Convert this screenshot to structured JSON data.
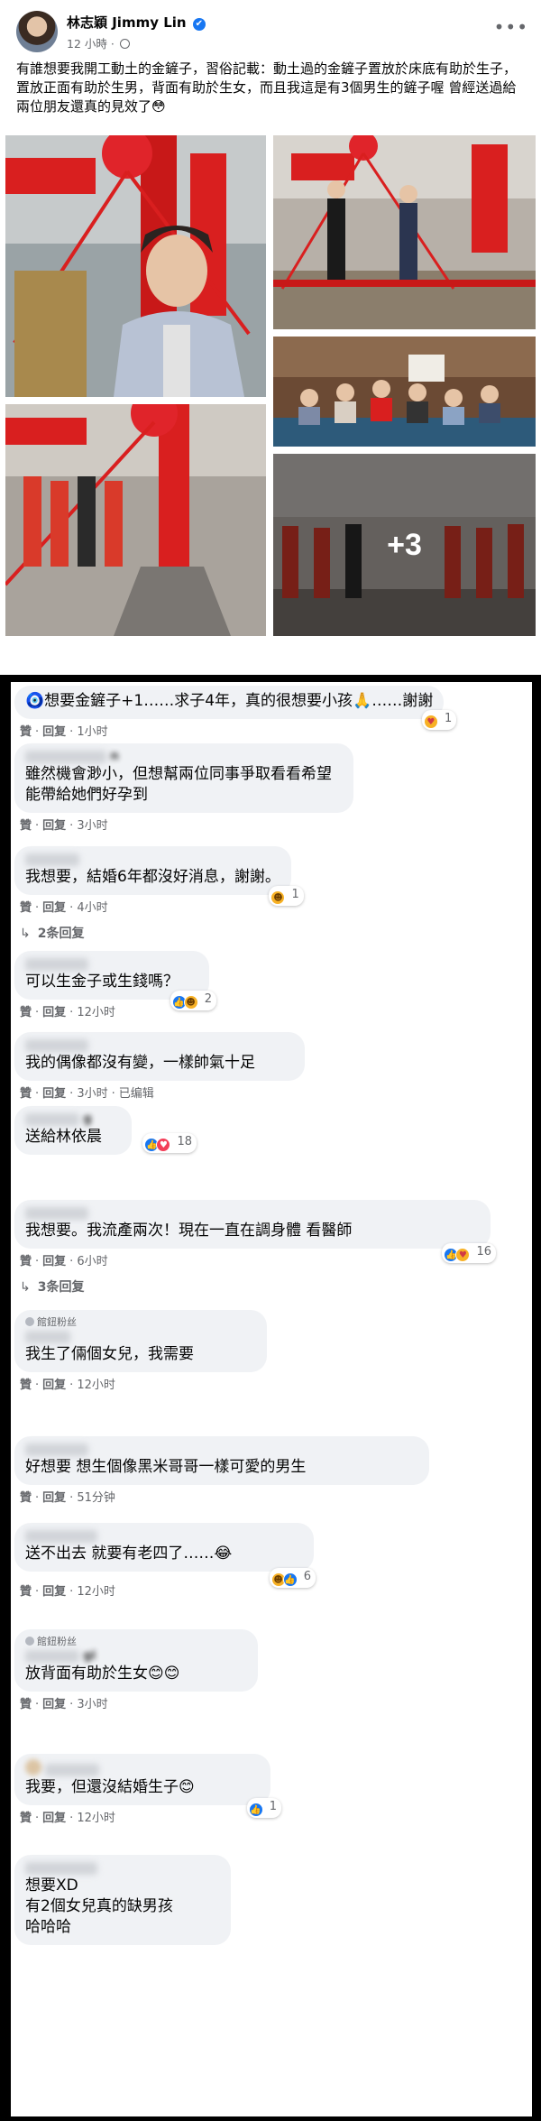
{
  "post": {
    "author_name": "林志穎 Jimmy Lin",
    "verified_mark": "✔",
    "time": "12 小時",
    "more_label": "•••",
    "text": "有誰想要我開工動土的金鏟子，習俗記載：動土過的金鏟子置放於床底有助於生子，置放正面有助於生男，背面有助於生女，而且我這是有3個男生的鏟子喔 曾經送過給兩位朋友還真的見效了😳",
    "more_photos": "+3",
    "colors": {
      "accent": "#1877f2",
      "banner_red": "#d91f1f"
    }
  },
  "comments": [
    {
      "text": "🧿想要金鏟子+1……求子4年，真的很想要小孩🙏……謝謝",
      "like": "贊",
      "reply": "回复",
      "time": "1小时",
      "reaction_icons": [
        "care"
      ],
      "reaction_count": "1"
    },
    {
      "name_hint": "n",
      "text": "雖然機會渺小，但想幫兩位同事爭取看看希望能帶給她們好孕到",
      "like": "贊",
      "reply": "回复",
      "time": "3小时"
    },
    {
      "text": "我想要，結婚6年都沒好消息，謝謝。",
      "like": "贊",
      "reply": "回复",
      "time": "4小时",
      "reaction_icons": [
        "haha"
      ],
      "reaction_count": "1",
      "replies": "2条回复"
    },
    {
      "text": "可以生金子或生錢嗎？",
      "like": "贊",
      "reply": "回复",
      "time": "12小时",
      "reaction_icons": [
        "like",
        "haha"
      ],
      "reaction_count": "2"
    },
    {
      "text": "我的偶像都沒有變，一樣帥氣十足",
      "like": "贊",
      "reply": "回复",
      "time": "3小时",
      "edited": "已编辑"
    },
    {
      "name_hint": "g",
      "text": "送給林依晨",
      "reaction_icons": [
        "like",
        "love"
      ],
      "reaction_count": "18"
    },
    {
      "text": "我想要。我流產兩次！現在一直在調身體 看醫師",
      "like": "贊",
      "reply": "回复",
      "time": "6小时",
      "reaction_icons": [
        "like",
        "care"
      ],
      "reaction_count": "16",
      "replies": "3条回复"
    },
    {
      "badge": "館鈕粉丝",
      "text": "我生了倆個女兒，我需要",
      "like": "贊",
      "reply": "回复",
      "time": "12小时"
    },
    {
      "text": "好想要 想生個像黑米哥哥一樣可愛的男生",
      "like": "贊",
      "reply": "回复",
      "time": "51分钟"
    },
    {
      "text": "送不出去 就要有老四了……😂",
      "like": "贊",
      "reply": "回复",
      "time": "12小时",
      "reaction_icons": [
        "haha",
        "like"
      ],
      "reaction_count": "6"
    },
    {
      "badge": "館鈕粉丝",
      "name_hint": "gi",
      "text": "放背面有助於生女😊😊",
      "like": "贊",
      "reply": "回复",
      "time": "3小时"
    },
    {
      "text": "我要，但還沒結婚生子😊",
      "like": "贊",
      "reply": "回复",
      "time": "12小时",
      "reaction_icons": [
        "like"
      ],
      "reaction_count": "1"
    },
    {
      "text": "想要XD\n有2個女兒真的缺男孩\n哈哈哈"
    }
  ]
}
